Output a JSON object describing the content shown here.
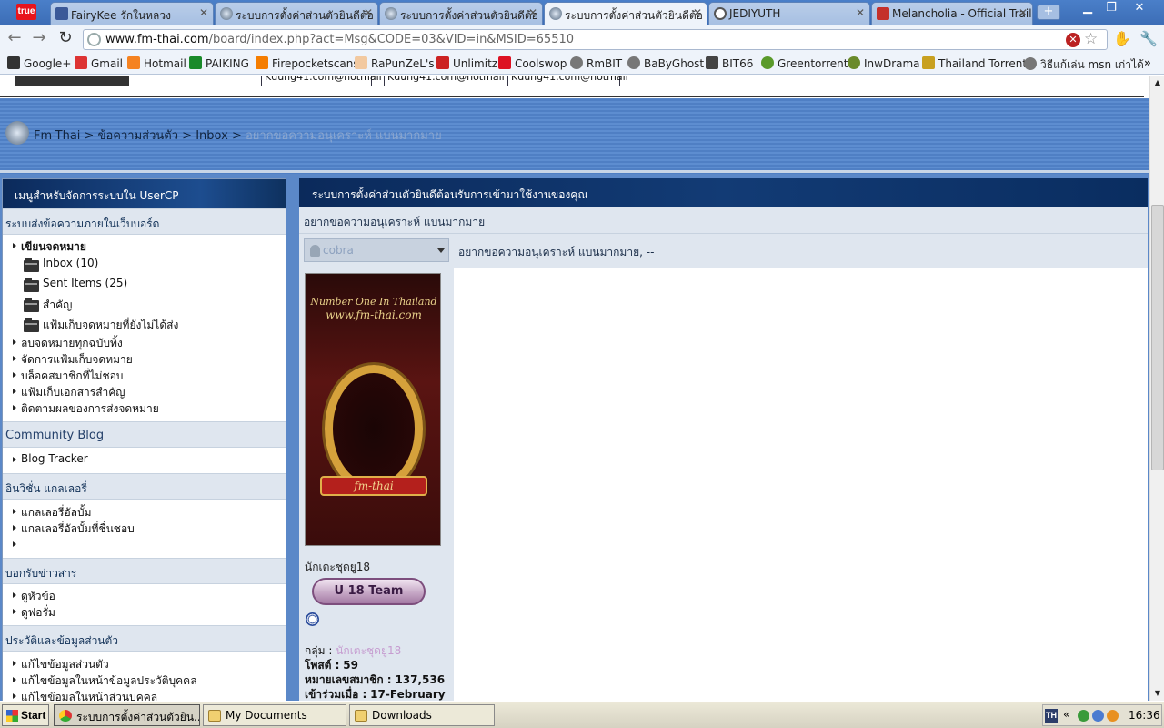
{
  "browser": {
    "tabs": [
      {
        "label": "FairyKee รักในหลวง",
        "icon": "facebook-icon"
      },
      {
        "label": "ระบบการตั้งค่าส่วนตัวยินดีต้อ",
        "icon": "fm-thai-icon"
      },
      {
        "label": "ระบบการตั้งค่าส่วนตัวยินดีต้อ",
        "icon": "fm-thai-icon"
      },
      {
        "label": "ระบบการตั้งค่าส่วนตัวยินดีต้อ",
        "icon": "fm-thai-icon"
      },
      {
        "label": "JEDIYUTH",
        "icon": "wordpress-icon"
      },
      {
        "label": "Melancholia - Official Trailer",
        "icon": "youtube-icon"
      }
    ],
    "active_tab": 3,
    "brand_logo": "true",
    "url_host": "www.fm-thai.com",
    "url_path": "/board/index.php?act=Msg&CODE=03&VID=in&MSID=65510",
    "bookmarks": [
      "Google+",
      "Gmail",
      "Hotmail",
      "PAIKING",
      "Firepocketscans",
      "RaPunZeL's",
      "Unlimitz",
      "Coolswop",
      "RmBIT",
      "BaByGhost",
      "BIT66",
      "Greentorrent",
      "InwDrama",
      "Thailand Torrent",
      "วิธีแก้เล่น msn เก่าได้"
    ]
  },
  "forum": {
    "signature_links": [
      "Kdung41.com@hotmail",
      "Kdung41.com@hotmail",
      "Kdung41.com@hotmail"
    ],
    "breadcrumb": {
      "home": "Fm-Thai",
      "section": "ข้อความส่วนตัว",
      "folder": "Inbox",
      "current": "อยากขอความอนุเคราะห์ แบนมากมาย",
      "separator": ">"
    },
    "sidebar": {
      "header": "เมนูสำหรับจัดการระบบใน UserCP",
      "sections": {
        "pm": "ระบบส่งข้อความภายในเว็บบอร์ด",
        "blog": "Community Blog",
        "gallery": "อินวิชั่น แกลเลอรี่",
        "subscriptions": "บอกรับข่าวสาร",
        "profile": "ประวัติและข้อมูลส่วนตัว"
      },
      "compose": "เขียนจดหมาย",
      "folders": [
        "Inbox (10)",
        "Sent Items (25)",
        "สำคัญ",
        "แฟ้มเก็บจดหมายที่ยังไม่ได้ส่ง"
      ],
      "pm_items": [
        "ลบจดหมายทุกฉบับทิ้ง",
        "จัดการแฟ้มเก็บจดหมาย",
        "บล็อคสมาชิกที่ไม่ชอบ",
        "แฟ้มเก็บเอกสารสำคัญ",
        "ติดตามผลของการส่งจดหมาย"
      ],
      "blog_items": [
        "Blog Tracker"
      ],
      "gallery_items": [
        "แกลเลอรี่อัลบั้ม",
        "แกลเลอรี่อัลบั้มที่ชื่นชอบ",
        ""
      ],
      "subscription_items": [
        "ดูหัวข้อ",
        "ดูฟอรั่ม"
      ],
      "profile_items": [
        "แก้ไขข้อมูลส่วนตัว",
        "แก้ไขข้อมูลในหน้าข้อมูลประวัติบุคคล",
        "แก้ไขข้อมูลในหน้าส่วนบุคคล"
      ]
    },
    "main": {
      "header": "ระบบการตั้งค่าส่วนตัวยินดีต้อนรับการเข้ามาใช้งานของคุณ",
      "subject": "อยากขอความอนุเคราะห์ แบนมากมาย",
      "author": "cobra",
      "message_title": "อยากขอความอนุเคราะห์ แบนมากมาย, --",
      "avatar": {
        "line1": "Number One In Thailand",
        "line2": "www.fm-thai.com",
        "ribbon": "fm-thai"
      },
      "user": {
        "status": "นักเตะชุดยู18",
        "badge": "U 18 Team",
        "group_label": "กลุ่ม :",
        "group_value": "นักเตะชุดยู18",
        "posts_label": "โพสต์ :",
        "posts_value": "59",
        "member_no_label": "หมายเลขสมาชิก :",
        "member_no_value": "137,536",
        "joined_label": "เข้าร่วมเมื่อ :",
        "joined_value": "17-February"
      }
    }
  },
  "taskbar": {
    "start": "Start",
    "buttons": [
      "ระบบการตั้งค่าส่วนตัวยิน...",
      "My Documents",
      "Downloads"
    ],
    "tray_badge": "TH",
    "clock": "16:36"
  }
}
